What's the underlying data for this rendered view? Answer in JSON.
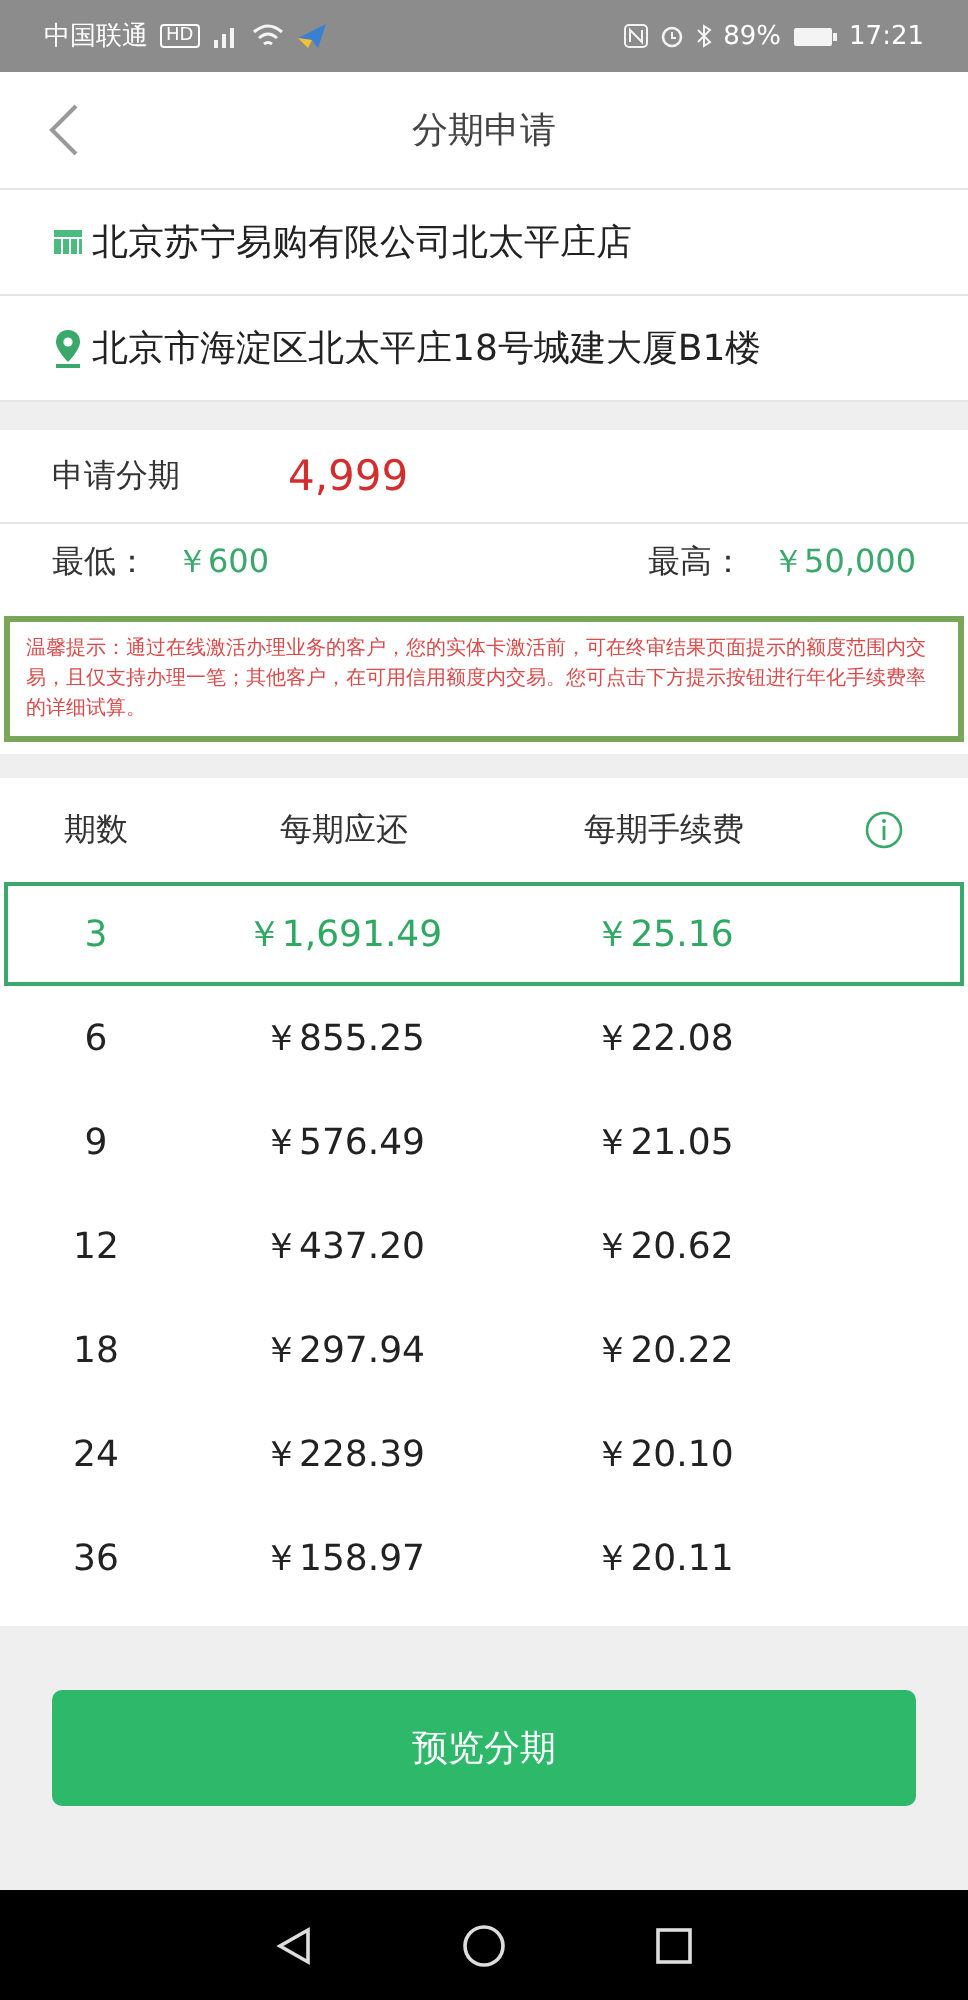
{
  "status_bar": {
    "carrier": "中国联通",
    "hd": "HD",
    "battery": "89%",
    "time": "17:21"
  },
  "header": {
    "title": "分期申请"
  },
  "store": {
    "name": "北京苏宁易购有限公司北太平庄店",
    "address": "北京市海淀区北太平庄18号城建大厦B1楼"
  },
  "application": {
    "label": "申请分期",
    "amount": "4,999",
    "min_label": "最低：",
    "min_value": "￥600",
    "max_label": "最高：",
    "max_value": "￥50,000"
  },
  "notice": "温馨提示：通过在线激活办理业务的客户，您的实体卡激活前，可在终审结果页面提示的额度范围内交易，且仅支持办理一笔；其他客户，在可用信用额度内交易。您可点击下方提示按钮进行年化手续费率的详细试算。",
  "table": {
    "columns": [
      "期数",
      "每期应还",
      "每期手续费"
    ],
    "rows": [
      {
        "term": "3",
        "payment": "￥1,691.49",
        "fee": "￥25.16",
        "selected": true
      },
      {
        "term": "6",
        "payment": "￥855.25",
        "fee": "￥22.08",
        "selected": false
      },
      {
        "term": "9",
        "payment": "￥576.49",
        "fee": "￥21.05",
        "selected": false
      },
      {
        "term": "12",
        "payment": "￥437.20",
        "fee": "￥20.62",
        "selected": false
      },
      {
        "term": "18",
        "payment": "￥297.94",
        "fee": "￥20.22",
        "selected": false
      },
      {
        "term": "24",
        "payment": "￥228.39",
        "fee": "￥20.10",
        "selected": false
      },
      {
        "term": "36",
        "payment": "￥158.97",
        "fee": "￥20.11",
        "selected": false
      }
    ]
  },
  "button": "预览分期"
}
